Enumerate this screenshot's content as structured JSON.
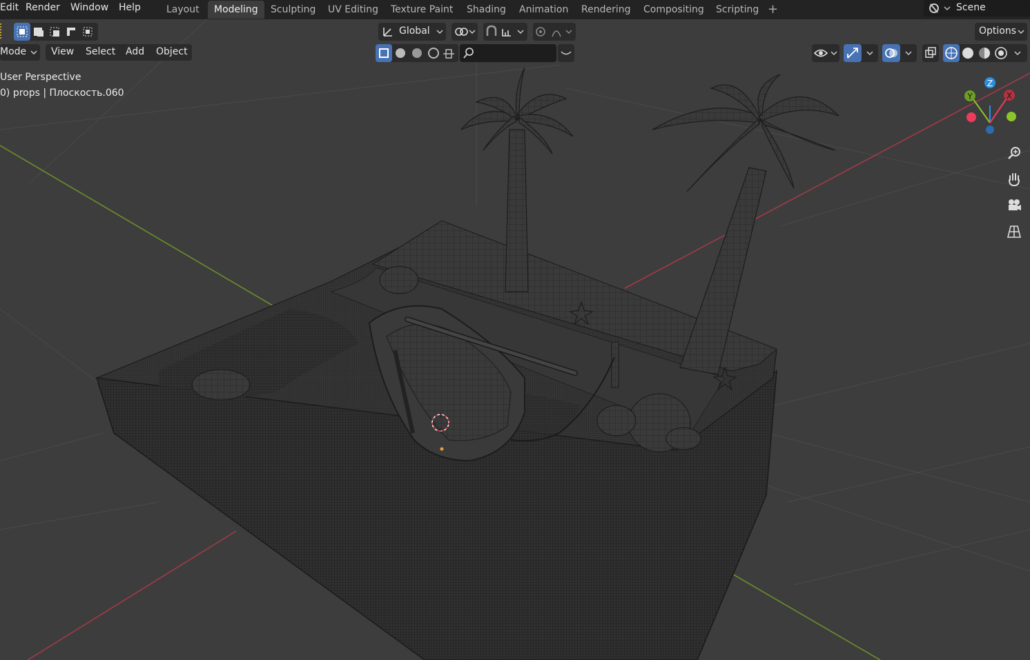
{
  "menubar": {
    "items": [
      "Edit",
      "Render",
      "Window",
      "Help"
    ]
  },
  "workspaces": {
    "tabs": [
      "Layout",
      "Modeling",
      "Sculpting",
      "UV Editing",
      "Texture Paint",
      "Shading",
      "Animation",
      "Rendering",
      "Compositing",
      "Scripting"
    ],
    "active": "Modeling",
    "add_label": "+"
  },
  "scene": {
    "label": "Scene"
  },
  "tool_header": {
    "orientation": "Global",
    "options_label": "Options"
  },
  "viewport_header": {
    "mode_label": "Mode",
    "menus": [
      "View",
      "Select",
      "Add",
      "Object"
    ]
  },
  "overlay_text": {
    "perspective": "User Perspective",
    "collection": "0) props | Плоскость.060"
  },
  "gizmo": {
    "x": "X",
    "y": "Y",
    "z": "Z"
  },
  "colors": {
    "accent": "#4772b3",
    "x_axis": "#ee3b5b",
    "y_axis": "#8bc52a",
    "z_axis": "#2b90e0",
    "background": "#3d3d3d"
  },
  "icons": {
    "zoom": "zoom-icon",
    "pan": "hand-icon",
    "camera": "camera-icon",
    "grid": "grid-icon"
  }
}
